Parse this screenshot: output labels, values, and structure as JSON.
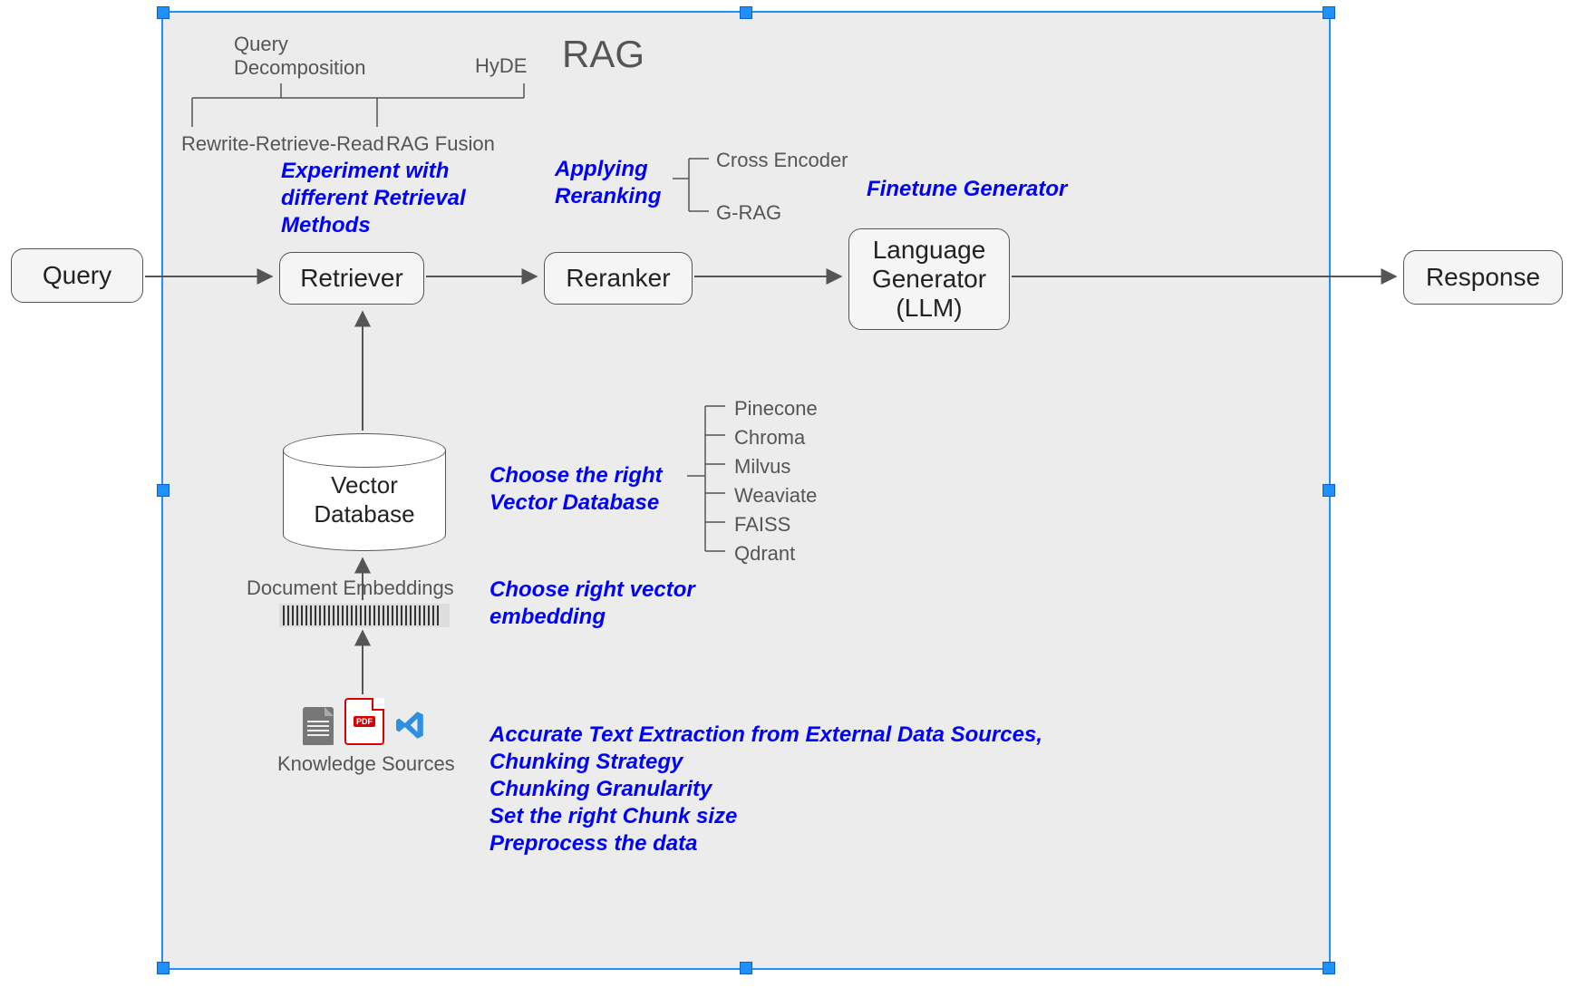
{
  "title": "RAG",
  "nodes": {
    "query": "Query",
    "retriever": "Retriever",
    "reranker": "Reranker",
    "generator": "Language\nGenerator\n(LLM)",
    "response": "Response",
    "vector_db": "Vector\nDatabase"
  },
  "retrieval_methods": {
    "qd": "Query\nDecomposition",
    "hyde": "HyDE",
    "rrr": "Rewrite-Retrieve-Read",
    "ragfusion": "RAG Fusion"
  },
  "reranking": {
    "cross_encoder": "Cross Encoder",
    "grag": "G-RAG"
  },
  "vector_dbs": {
    "0": "Pinecone",
    "1": "Chroma",
    "2": "Milvus",
    "3": "Weaviate",
    "4": "FAISS",
    "5": "Qdrant"
  },
  "blue": {
    "exp_retrieval": "Experiment with\ndifferent Retrieval\nMethods",
    "applying_reranking": "Applying\nReranking",
    "finetune_generator": "Finetune Generator",
    "choose_vector_db": "Choose the right\nVector Database",
    "choose_embedding": "Choose right vector\nembedding",
    "knowledge_sources_notes": "Accurate Text Extraction from External Data Sources,\nChunking Strategy\nChunking Granularity\nSet the right Chunk size\nPreprocess the data"
  },
  "misc": {
    "doc_embeddings": "Document Embeddings",
    "knowledge_sources": "Knowledge Sources",
    "pdf_tag": "PDF"
  }
}
